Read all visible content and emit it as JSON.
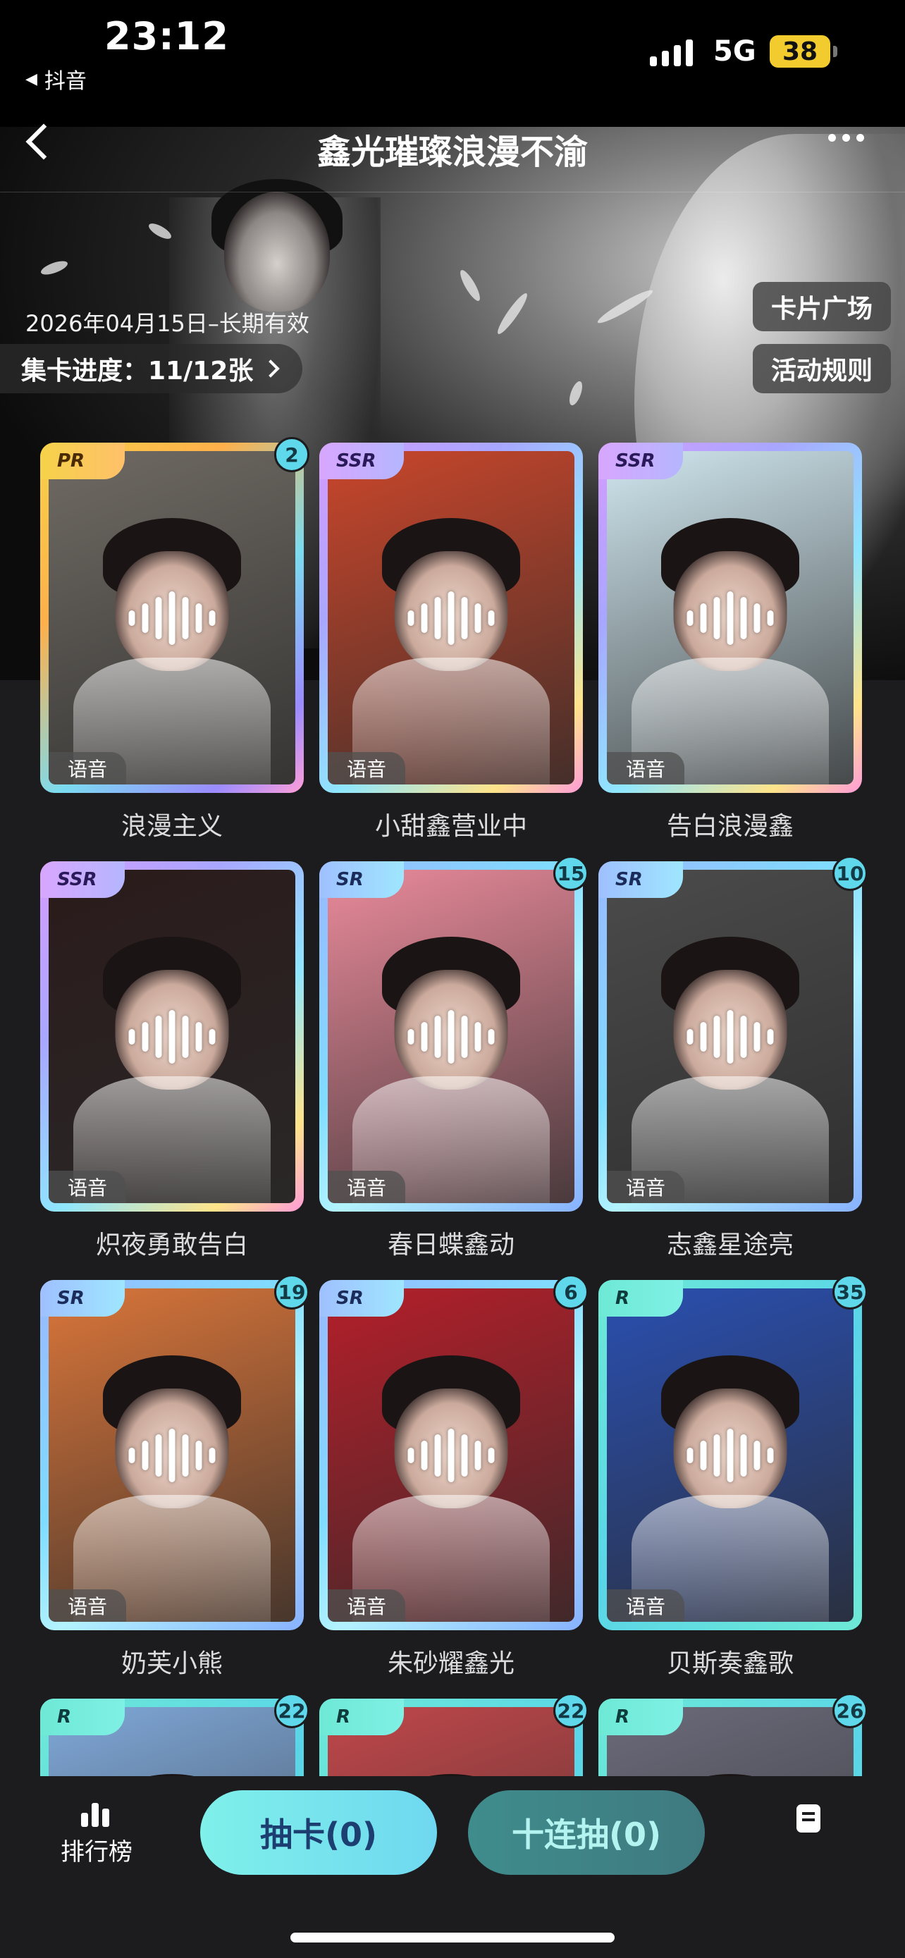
{
  "status_bar": {
    "time": "23:12",
    "back_app": "抖音",
    "network": "5G",
    "battery": "38"
  },
  "header": {
    "title": "鑫光璀璨浪漫不渝"
  },
  "hero": {
    "date": "2026年04月15日–长期有效",
    "progress_label": "集卡进度：11/12张",
    "card_plaza": "卡片广场",
    "rules": "活动规则"
  },
  "colors": {
    "accent": "#5ed8ea",
    "draw_button": "#7ff0ea",
    "background": "#1c1c1e"
  },
  "cards": [
    {
      "name": "浪漫主义",
      "rarity": "PR",
      "count": "2",
      "voice": "语音",
      "tone": "#6f6a63",
      "frame": "pr"
    },
    {
      "name": "小甜鑫营业中",
      "rarity": "SSR",
      "count": "",
      "voice": "语音",
      "tone": "#c9462b",
      "frame": "ssr"
    },
    {
      "name": "告白浪漫鑫",
      "rarity": "SSR",
      "count": "",
      "voice": "语音",
      "tone": "#cfe6ee",
      "frame": "ssr"
    },
    {
      "name": "炽夜勇敢告白",
      "rarity": "SSR",
      "count": "",
      "voice": "语音",
      "tone": "#2b1b1b",
      "frame": "ssr"
    },
    {
      "name": "春日蝶鑫动",
      "rarity": "SR",
      "count": "15",
      "voice": "语音",
      "tone": "#e98a9a",
      "frame": "sr"
    },
    {
      "name": "志鑫星途亮",
      "rarity": "SR",
      "count": "10",
      "voice": "语音",
      "tone": "#4b4b4b",
      "frame": "sr"
    },
    {
      "name": "奶芙小熊",
      "rarity": "SR",
      "count": "19",
      "voice": "语音",
      "tone": "#d9753a",
      "frame": "sr"
    },
    {
      "name": "朱砂耀鑫光",
      "rarity": "SR",
      "count": "6",
      "voice": "语音",
      "tone": "#b41f2a",
      "frame": "sr"
    },
    {
      "name": "贝斯奏鑫歌",
      "rarity": "R",
      "count": "35",
      "voice": "语音",
      "tone": "#2a4fb0",
      "frame": "r"
    },
    {
      "name": "",
      "rarity": "R",
      "count": "22",
      "voice": "",
      "tone": "#7fa8d8",
      "frame": "r"
    },
    {
      "name": "",
      "rarity": "R",
      "count": "22",
      "voice": "",
      "tone": "#c0474a",
      "frame": "r"
    },
    {
      "name": "",
      "rarity": "R",
      "count": "26",
      "voice": "",
      "tone": "#6a6a7a",
      "frame": "r"
    }
  ],
  "bottom": {
    "ranking": "排行榜",
    "draw": "抽卡(0)",
    "draw10": "十连抽(0)"
  }
}
